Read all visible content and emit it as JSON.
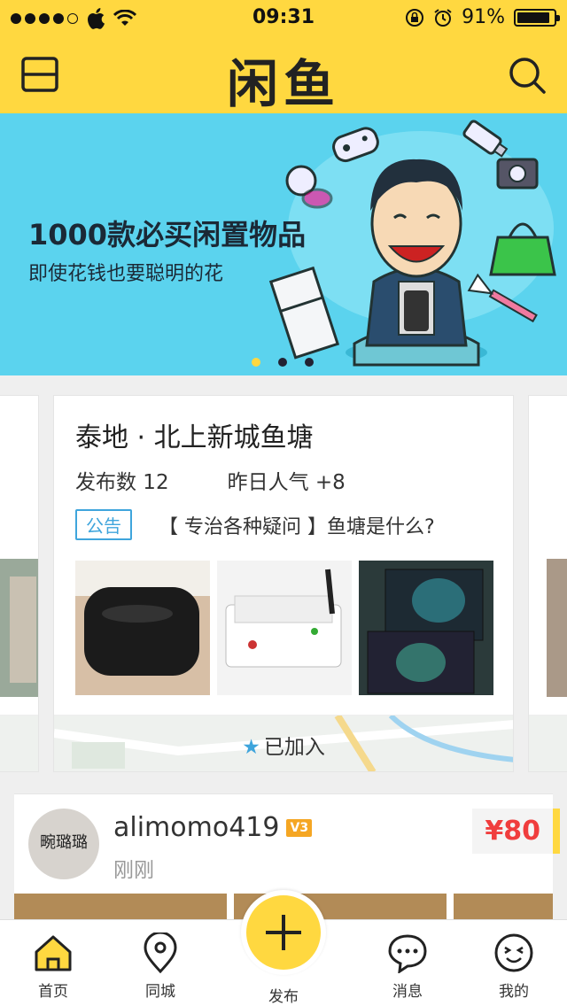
{
  "status_bar": {
    "time": "09:31",
    "battery": "91%",
    "battery_level": 0.91
  },
  "nav": {
    "logo": "闲鱼",
    "menu_icon": "menu-icon",
    "search_icon": "search-icon"
  },
  "banner": {
    "title": "1000款必买闲置物品",
    "subtitle": "即使花钱也要聪明的花",
    "active_page": 0,
    "page_count": 3
  },
  "pond_card": {
    "title": "泰地 · 北上新城鱼塘",
    "posts": "发布数 12",
    "popularity": "昨日人气 +8",
    "notice_tag": "公告",
    "notice_text": "【 专治各种疑问 】鱼塘是什么?",
    "joined_label": "已加入"
  },
  "feed": {
    "username": "alimomo419",
    "level_badge": "V3",
    "time": "刚刚",
    "price": "¥80",
    "avatar_text": "畹璐璐"
  },
  "tabbar": {
    "home": "首页",
    "city": "同城",
    "publish": "发布",
    "messages": "消息",
    "mine": "我的"
  },
  "colors": {
    "brand_yellow": "#ffd840",
    "banner_blue": "#5bd3ee",
    "tag_blue": "#3fa5dc",
    "price_red": "#f03d3d"
  }
}
